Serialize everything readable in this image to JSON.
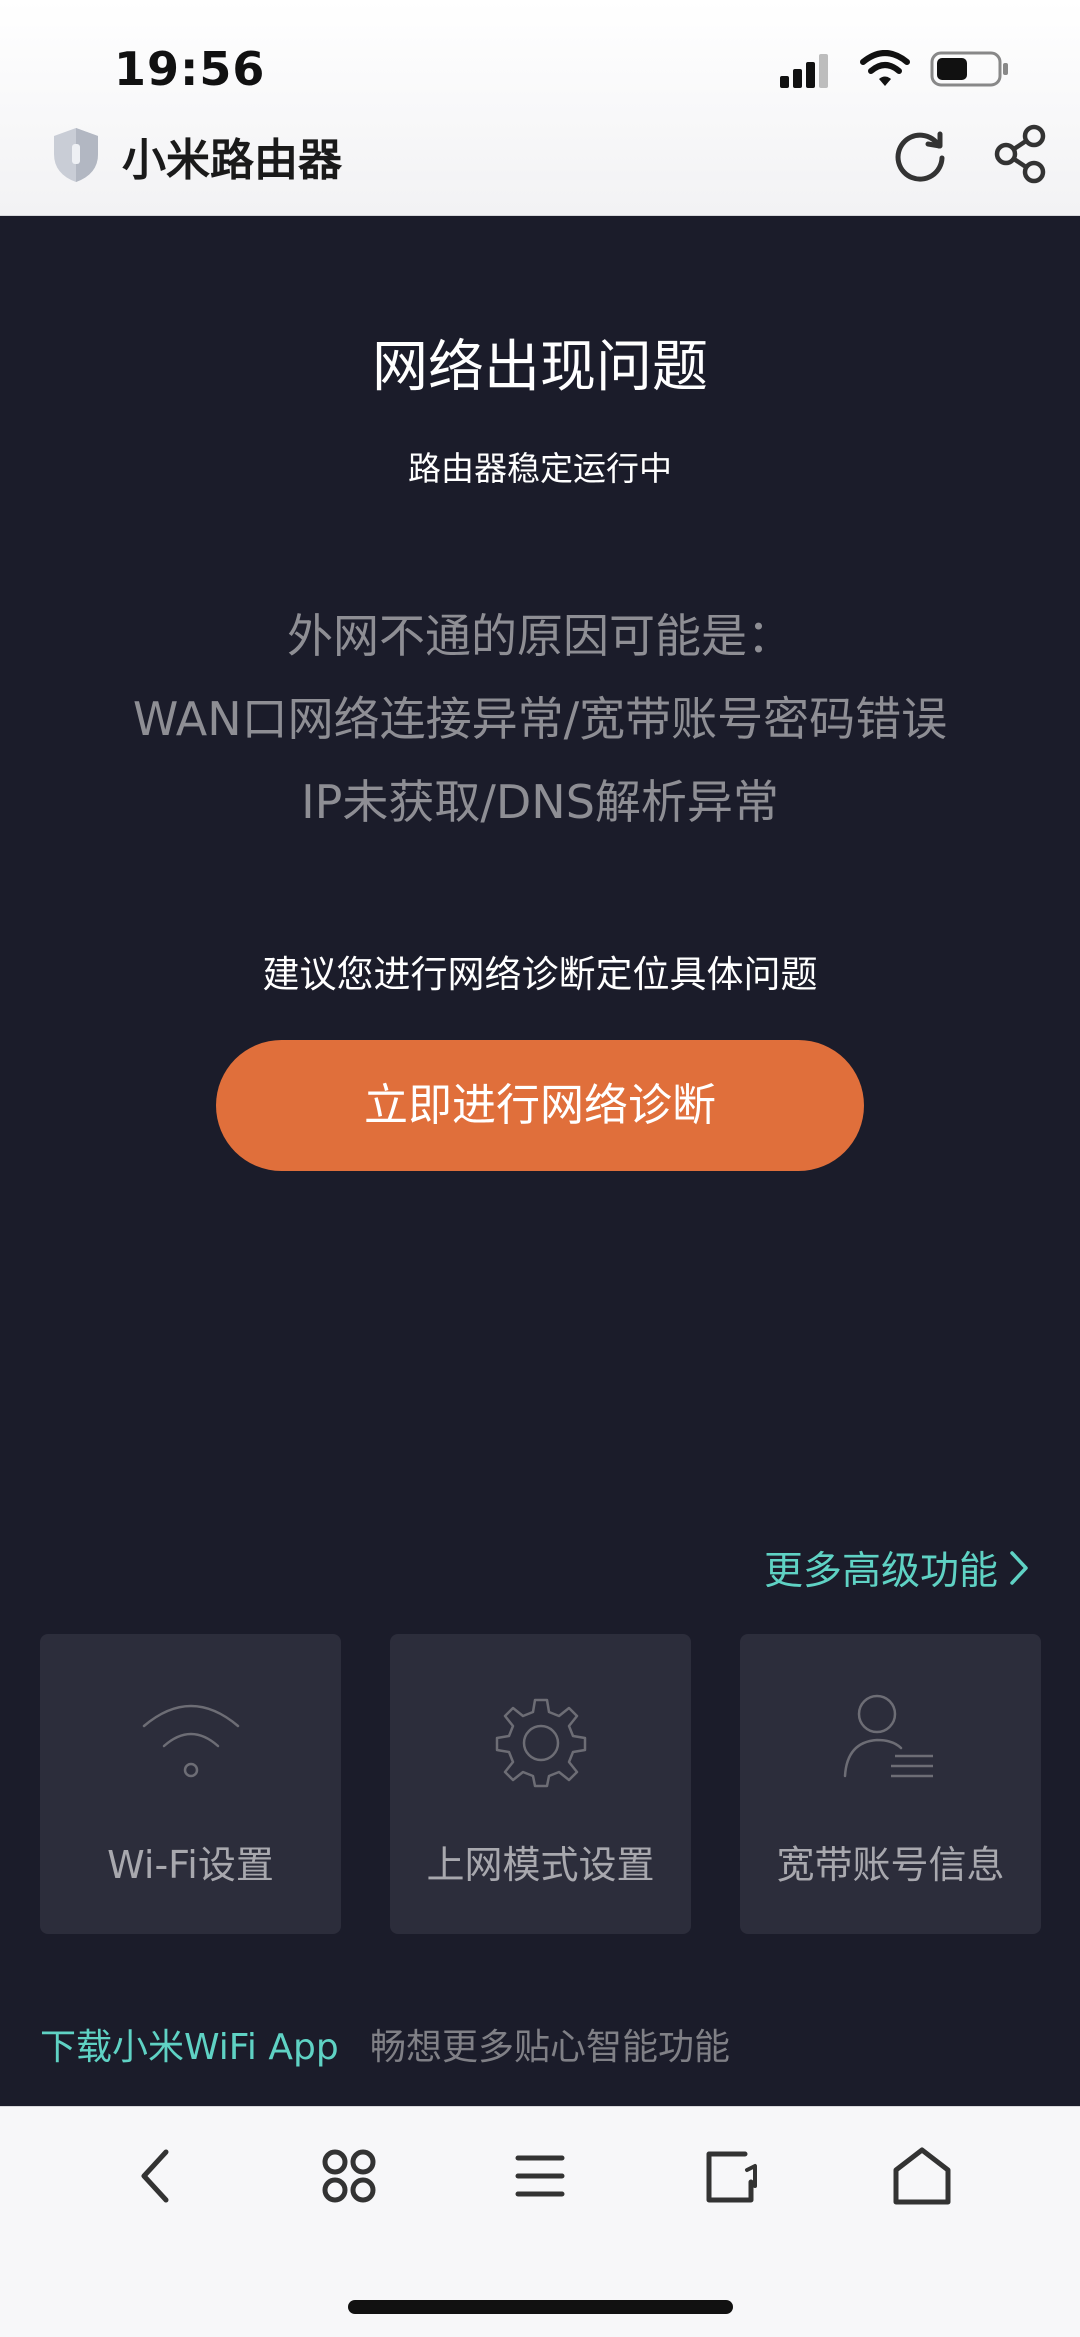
{
  "status_bar": {
    "time": "19:56"
  },
  "browser": {
    "title": "小米路由器"
  },
  "main": {
    "title": "网络出现问题",
    "subtitle": "路由器稳定运行中",
    "reasons": [
      "外网不通的原因可能是：",
      "WAN口网络连接异常/宽带账号密码错误",
      "IP未获取/DNS解析异常"
    ],
    "suggestion": "建议您进行网络诊断定位具体问题",
    "diagnose_button": "立即进行网络诊断"
  },
  "more_link": "更多高级功能",
  "cards": [
    {
      "label": "Wi-Fi设置",
      "icon": "wifi-icon"
    },
    {
      "label": "上网模式设置",
      "icon": "gear-icon"
    },
    {
      "label": "宽带账号信息",
      "icon": "user-account-icon"
    }
  ],
  "footer": {
    "link": "下载小米WiFi App",
    "text": "畅想更多贴心智能功能"
  },
  "colors": {
    "background": "#1b1c2a",
    "accent": "#e06f3b",
    "link": "#5fd2c4",
    "card": "#2c2d3b"
  }
}
